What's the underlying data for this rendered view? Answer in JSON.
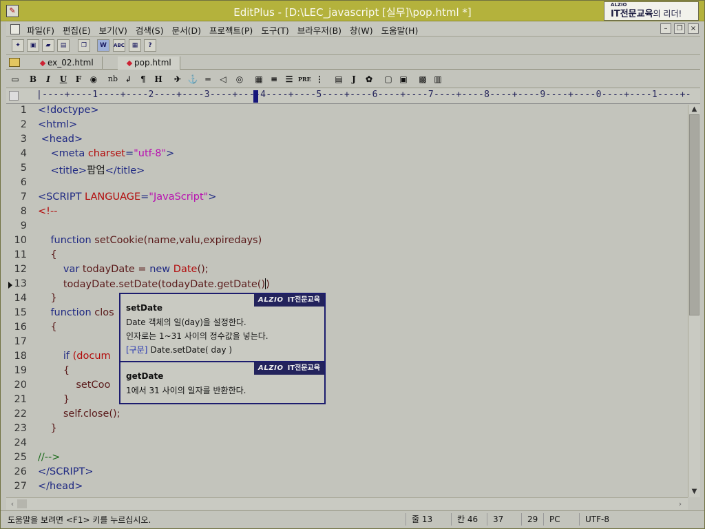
{
  "window": {
    "title": "EditPlus - [D:\\LEC_javascript [실무]\\pop.html *]",
    "brand_small": "ALZIO",
    "brand_main": "IT전문교육",
    "brand_rest": "의 리더!"
  },
  "menu": {
    "items": [
      "파일(F)",
      "편집(E)",
      "보기(V)",
      "검색(S)",
      "문서(D)",
      "프로젝트(P)",
      "도구(T)",
      "브라우저(B)",
      "창(W)",
      "도움말(H)"
    ]
  },
  "window_controls": {
    "minimize": "–",
    "restore": "❐",
    "close": "×"
  },
  "toolbar1": {
    "word_wrap": "W",
    "abc": "ABC",
    "help": "?"
  },
  "tabs": [
    {
      "label": "ex_02.html"
    },
    {
      "label": "pop.html"
    }
  ],
  "format_toolbar": {
    "bold": "B",
    "italic": "I",
    "underline": "U",
    "font": "F",
    "nbsp": "nb",
    "br": "↲",
    "para": "¶",
    "heading": "H",
    "pre": "PRE",
    "script": "J"
  },
  "ruler": {
    "text": "|----+----1----+----2----+----3----+----4----+----5----+----6----+----7----+----8----+----9----+----0----+----1----+----2----+----3----+"
  },
  "editor": {
    "lines": [
      {
        "n": "1",
        "html": "<span class=\"tag\">&lt;!doctype&gt;</span>"
      },
      {
        "n": "2",
        "html": "<span class=\"tag\">&lt;html&gt;</span>"
      },
      {
        "n": "3",
        "html": " <span class=\"tag\">&lt;head&gt;</span>"
      },
      {
        "n": "4",
        "html": "    <span class=\"tag\">&lt;meta </span><span class=\"attr\">charset</span><span class=\"tag\">=</span><span class=\"str\">\"utf-8\"</span><span class=\"tag\">&gt;</span>"
      },
      {
        "n": "5",
        "html": "    <span class=\"tag\">&lt;title&gt;</span>팝업<span class=\"tag\">&lt;/title&gt;</span>"
      },
      {
        "n": "6",
        "html": ""
      },
      {
        "n": "7",
        "html": "<span class=\"tag\">&lt;SCRIPT </span><span class=\"attr\">LANGUAGE</span><span class=\"tag\">=</span><span class=\"str\">\"JavaScript\"</span><span class=\"tag\">&gt;</span>"
      },
      {
        "n": "8",
        "html": "<span class=\"attr\">&lt;!--</span>"
      },
      {
        "n": "9",
        "html": ""
      },
      {
        "n": "10",
        "html": "    <span class=\"kw\">function</span> <span class=\"def\">setCookie(name,valu,expiredays)</span>"
      },
      {
        "n": "11",
        "html": "    <span class=\"def\">{</span>"
      },
      {
        "n": "12",
        "html": "        <span class=\"kw\">var</span> <span class=\"def\">todayDate = </span><span class=\"kw\">new</span> <span class=\"attr\">Date</span><span class=\"def\">();</span>"
      },
      {
        "n": "13",
        "html": "        <span class=\"def\">todayDate.setDate(todayDate.getDate()</span><span class=\"caret\"></span><span class=\"def\">)</span>"
      },
      {
        "n": "14",
        "html": "    <span class=\"def\">}</span>"
      },
      {
        "n": "15",
        "html": "    <span class=\"kw\">function</span> <span class=\"def\">clos</span>"
      },
      {
        "n": "16",
        "html": "    <span class=\"def\">{</span>"
      },
      {
        "n": "17",
        "html": ""
      },
      {
        "n": "18",
        "html": "        <span class=\"kw\">if</span> <span class=\"attr\">(docum</span>"
      },
      {
        "n": "19",
        "html": "        <span class=\"def\">{</span>"
      },
      {
        "n": "20",
        "html": "            <span class=\"def\">setCoo</span>"
      },
      {
        "n": "21",
        "html": "        <span class=\"def\">}</span>"
      },
      {
        "n": "22",
        "html": "        <span class=\"def\">self.close();</span>"
      },
      {
        "n": "23",
        "html": "    <span class=\"def\">}</span>"
      },
      {
        "n": "24",
        "html": ""
      },
      {
        "n": "25",
        "html": "<span class=\"cmt\">//--&gt;</span>"
      },
      {
        "n": "26",
        "html": "<span class=\"tag\">&lt;/SCRIPT&gt;</span>"
      },
      {
        "n": "27",
        "html": "<span class=\"tag\">&lt;/head&gt;</span>"
      }
    ],
    "current_line": "13"
  },
  "popup": {
    "brand_a": "ALZIO",
    "brand_b": "IT전문교육",
    "cards": [
      {
        "name": "setDate",
        "desc1": "Date 객체의 일(day)을 설정한다.",
        "desc2": "인자로는 1~31 사이의 정수값을 넣는다.",
        "syntax_label": "[구문]",
        "syntax": "Date.setDate( day )"
      },
      {
        "name": "getDate",
        "desc1": "1에서 31 사이의 일자를 반환한다."
      }
    ]
  },
  "status": {
    "message": "도움말을 보려면 <F1> 키를 누르십시오.",
    "line": "줄 13",
    "col": "칸 46",
    "offset": "37",
    "count": "29",
    "eol": "PC",
    "encoding": "UTF-8"
  }
}
